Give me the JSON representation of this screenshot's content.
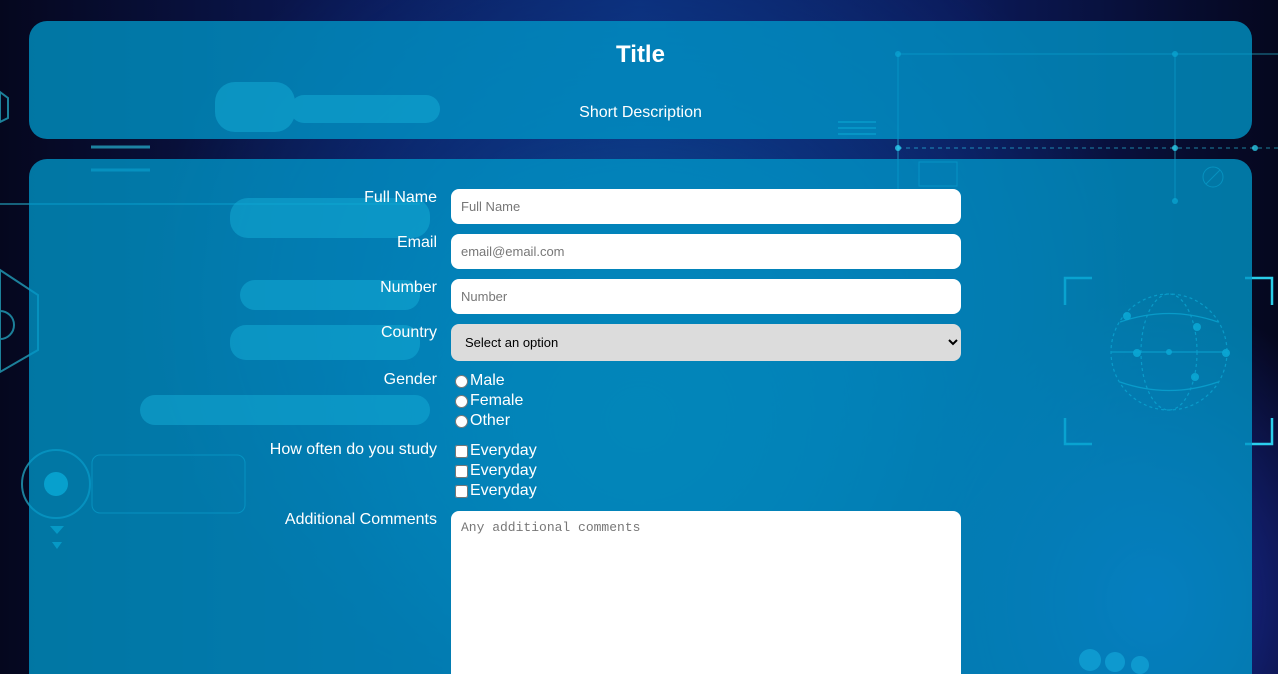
{
  "header": {
    "title": "Title",
    "description": "Short Description"
  },
  "form": {
    "full_name": {
      "label": "Full Name",
      "placeholder": "Full Name",
      "value": ""
    },
    "email": {
      "label": "Email",
      "placeholder": "email@email.com",
      "value": ""
    },
    "number": {
      "label": "Number",
      "placeholder": "Number",
      "value": ""
    },
    "country": {
      "label": "Country",
      "selected": "Select an option"
    },
    "gender": {
      "label": "Gender",
      "options": [
        {
          "label": "Male",
          "checked": false
        },
        {
          "label": "Female",
          "checked": false
        },
        {
          "label": "Other",
          "checked": false
        }
      ]
    },
    "study": {
      "label": "How often do you study",
      "options": [
        {
          "label": "Everyday",
          "checked": false
        },
        {
          "label": "Everyday",
          "checked": false
        },
        {
          "label": "Everyday",
          "checked": false
        }
      ]
    },
    "comments": {
      "label": "Additional Comments",
      "placeholder": "Any additional comments",
      "value": ""
    }
  },
  "theme": {
    "panel_color": "#0096c8",
    "accent_cyan": "#29e6ff",
    "background_dark": "#05071e"
  }
}
